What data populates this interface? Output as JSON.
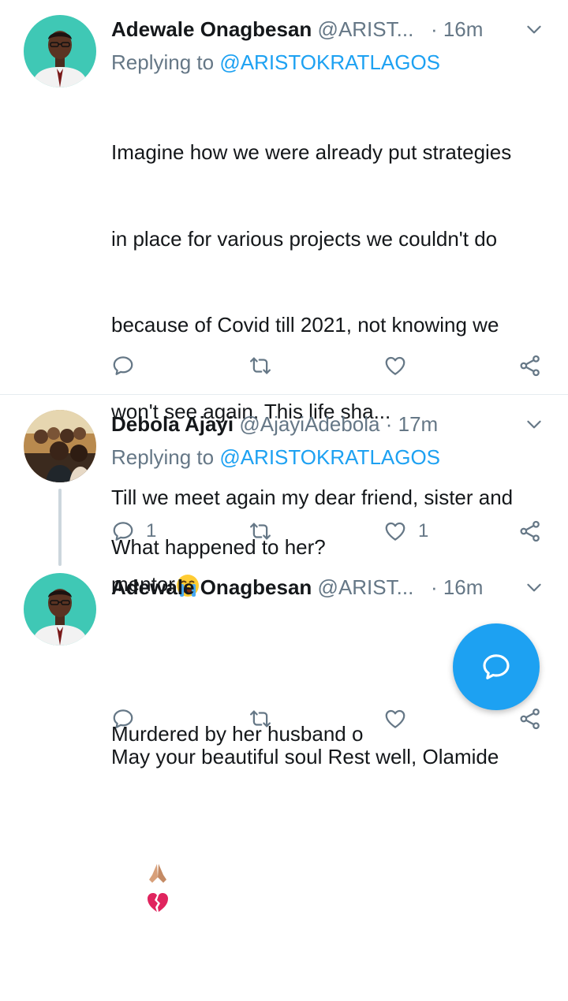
{
  "tweets": [
    {
      "name": "Adewale Onagbesan",
      "handle": "@ARIST...",
      "time": "· 16m",
      "replying_prefix": "Replying to ",
      "replying_to": "@ARISTOKRATLAGOS",
      "lines": [
        "Imagine how we were already put strategies",
        "in place for various projects we couldn't do",
        "because of Covid till 2021, not knowing we",
        "won't see again. This life sha...",
        "Till we meet again my dear friend, sister and",
        "mentor",
        "",
        "May your beautiful soul Rest well, Olamide"
      ],
      "emoji": [
        "loudly-crying-face",
        "folded-hands",
        "broken-heart"
      ],
      "reply_count": "",
      "retweet_count": "",
      "like_count": ""
    },
    {
      "name": "Debola Ajayi",
      "handle": "@AjayiAdebola",
      "time": "· 17m",
      "replying_prefix": "Replying to ",
      "replying_to": "@ARISTOKRATLAGOS",
      "lines": [
        "What happened to her?"
      ],
      "reply_count": "1",
      "retweet_count": "",
      "like_count": "1"
    },
    {
      "name": "Adewale Onagbesan",
      "handle": "@ARIST...",
      "time": "· 16m",
      "lines": [
        "Murdered by her husband o"
      ],
      "reply_count": "",
      "retweet_count": "",
      "like_count": ""
    }
  ],
  "colors": {
    "accent": "#1da1f2",
    "secondary_text": "#657786",
    "icon": "#657786"
  },
  "icons": {
    "reply": "reply-icon",
    "retweet": "retweet-icon",
    "like": "heart-icon",
    "share": "share-icon",
    "menu": "chevron-down-icon",
    "compose": "compose-reply-icon"
  }
}
